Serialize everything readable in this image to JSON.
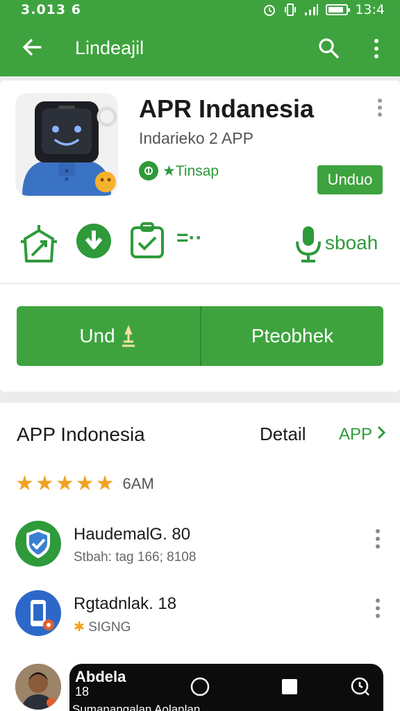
{
  "status_bar": {
    "left_text": "3.013 6",
    "time": "13:4",
    "battery_level": 0.85
  },
  "app_bar": {
    "title": "Lindeajil"
  },
  "header": {
    "app_name": "APR Indanesia",
    "subtitle": "Indarieko 2 APP",
    "badge_label": "★Tinsap",
    "install_label": "Unduo"
  },
  "info_row": {
    "right_label": "sboah",
    "dots_label": "=··"
  },
  "actions": {
    "left_label": "Und",
    "right_label": "Pteobhek"
  },
  "section": {
    "title": "APP Indonesia",
    "detail_label": "Detail",
    "link_label": "APP",
    "rating_stars": 5,
    "rating_text": "6AM"
  },
  "list": [
    {
      "title": "HaudemalG. 80",
      "subtitle": "Stbah: tag 166; 8108",
      "icon": "shield-check-icon"
    },
    {
      "title": "Rgtadnlak. 18",
      "subtitle": "SIGNG",
      "icon": "phone-icon"
    },
    {
      "title": "Abdela",
      "subtitle": "18",
      "icon": "person-avatar"
    }
  ],
  "bottom": {
    "cut_text": "Sumanangalan Aolanlan"
  },
  "colors": {
    "brand_green": "#3ea33e",
    "accent_green": "#2e9a3a",
    "star": "#f0a322"
  }
}
